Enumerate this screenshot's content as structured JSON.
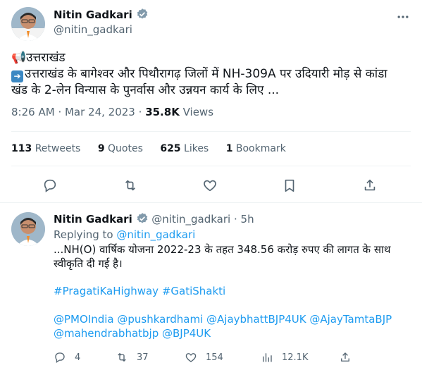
{
  "main_tweet": {
    "author_name": "Nitin Gadkari",
    "author_handle": "@nitin_gadkari",
    "line1_emoji": "📢",
    "line1_text": "उत्तराखंड",
    "line2_emoji": "➡️",
    "line2_text": "उत्तराखंड के बागेश्वर और पिथौरागढ़ जिलों में NH-309A पर उदियारी मोड़ से कांडा",
    "line3_text": "खंड के 2-लेन विन्यास के पुनर्वास और उन्नयन कार्य के लिए ...",
    "time": "8:26 AM",
    "date": "Mar 24, 2023",
    "views_count": "35.8K",
    "views_label": "Views",
    "stats": {
      "retweets_count": "113",
      "retweets_label": "Retweets",
      "quotes_count": "9",
      "quotes_label": "Quotes",
      "likes_count": "625",
      "likes_label": "Likes",
      "bookmarks_count": "1",
      "bookmarks_label": "Bookmark"
    }
  },
  "reply_tweet": {
    "author_name": "Nitin Gadkari",
    "author_handle": "@nitin_gadkari",
    "time_ago": "5h",
    "replying_label": "Replying to",
    "replying_handle": "@nitin_gadkari",
    "text_line1": "...NH(O) वार्षिक योजना 2022-23 के तहत 348.56 करोड़ रुपए की लागत के साथ",
    "text_line2": "स्वीकृति दी गई है।",
    "hashtags": "#PragatiKaHighway #GatiShakti",
    "mentions_line1": "@PMOIndia @pushkardhami @AjaybhattBJP4UK @AjayTamtaBJP",
    "mentions_line2": "@mahendrabhatbjp @BJP4UK",
    "actions": {
      "replies": "4",
      "retweets": "37",
      "likes": "154",
      "views": "12.1K"
    }
  },
  "colors": {
    "accent": "#1d9bf0",
    "text": "#0f1419",
    "secondary": "#536471",
    "divider": "#eff3f4"
  }
}
